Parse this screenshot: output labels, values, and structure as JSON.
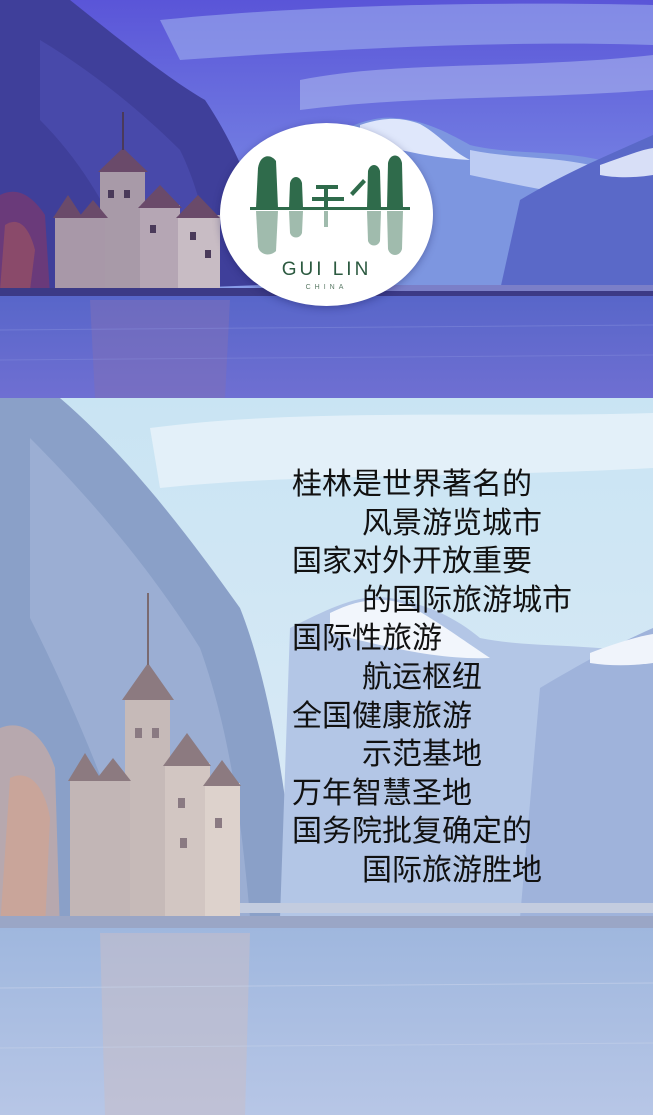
{
  "logo": {
    "title": "GUI LIN",
    "subtitle": "CHINA"
  },
  "lines": [
    {
      "text": "桂林是世界著名的",
      "indent": false
    },
    {
      "text": "风景游览城市",
      "indent": true
    },
    {
      "text": "国家对外开放重要",
      "indent": false
    },
    {
      "text": "的国际旅游城市",
      "indent": true
    },
    {
      "text": "国际性旅游",
      "indent": false
    },
    {
      "text": "航运枢纽",
      "indent": true
    },
    {
      "text": "全国健康旅游",
      "indent": false
    },
    {
      "text": "示范基地",
      "indent": true
    },
    {
      "text": "万年智慧圣地",
      "indent": false
    },
    {
      "text": "国务院批复确定的",
      "indent": false
    },
    {
      "text": "国际旅游胜地",
      "indent": true
    }
  ],
  "colors": {
    "top_tint": "#5a4fd0",
    "bottom_tint": "#c9d9ef",
    "logo_green": "#2f6b4b",
    "text": "#111111"
  }
}
